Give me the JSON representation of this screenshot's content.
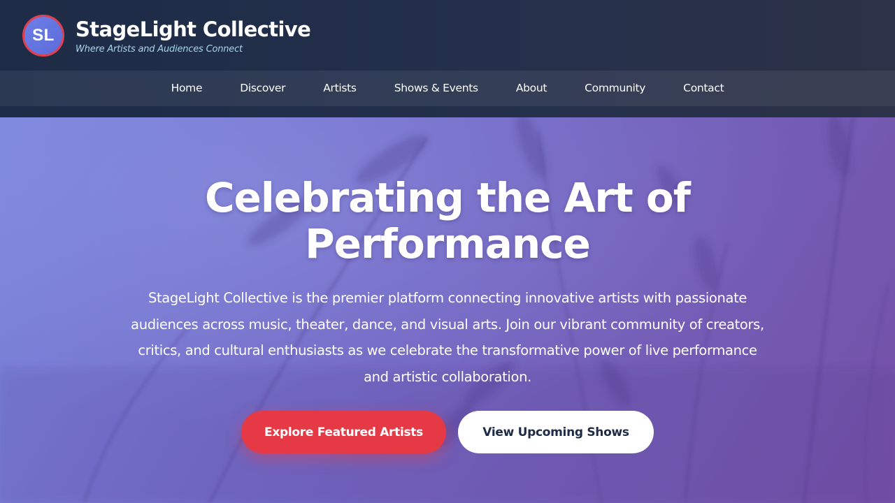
{
  "brand": {
    "logo_initials": "SL",
    "title": "StageLight Collective",
    "tagline": "Where Artists and Audiences Connect"
  },
  "nav": {
    "items": [
      {
        "label": "Home"
      },
      {
        "label": "Discover"
      },
      {
        "label": "Artists"
      },
      {
        "label": "Shows & Events"
      },
      {
        "label": "About"
      },
      {
        "label": "Community"
      },
      {
        "label": "Contact"
      }
    ]
  },
  "hero": {
    "title_line1": "Celebrating the Art of",
    "title_line2": "Performance",
    "description": "StageLight Collective is the premier platform connecting innovative artists with passionate audiences across music, theater, dance, and visual arts. Join our vibrant community of creators, critics, and cultural enthusiasts as we celebrate the transformative power of live performance and artistic collaboration.",
    "primary_button": "Explore Featured Artists",
    "secondary_button": "View Upcoming Shows",
    "background_image": "wheat-field-photo"
  },
  "colors": {
    "header_bg": "#1d2b46",
    "accent_red": "#e63946",
    "tagline": "#a8d6ea",
    "hero_gradient_start": "#7b86dc",
    "hero_gradient_end": "#7450a6"
  }
}
